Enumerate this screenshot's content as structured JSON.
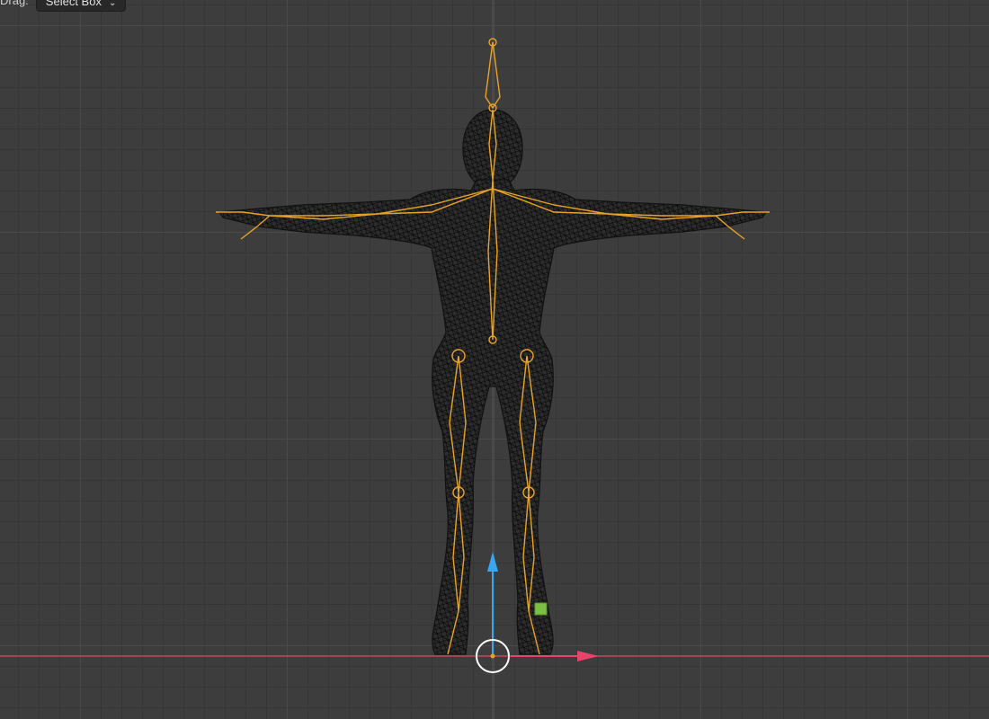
{
  "header": {
    "drag_label": "Drag:",
    "select_mode": "Select Box"
  },
  "icons": {
    "dropdown": "chevron-down-icon",
    "cursor": "3d-cursor-icon",
    "gizmo_up": "axis-arrow-up-icon",
    "gizmo_right": "axis-arrow-right-icon",
    "gizmo_handle": "scale-handle-icon"
  },
  "colors": {
    "background": "#3d3d3d",
    "grid_major": "#4a4a4a",
    "grid_minor": "#363636",
    "x_axis": "#d4435a",
    "bone": "#e8a325",
    "bone_selected": "#f2c75b",
    "mesh_wire": "#0a0a0a",
    "mesh_fill": "#2d2d2d",
    "gizmo_blue": "#3aa6f0",
    "gizmo_red": "#e8436a",
    "gizmo_green": "#7ac142",
    "cursor": "#ffffff"
  }
}
